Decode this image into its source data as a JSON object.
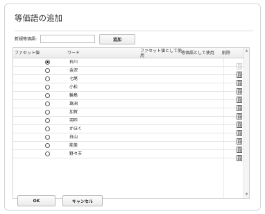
{
  "dialog": {
    "title": "等価語の追加",
    "new_synonym_label": "新規等価語:",
    "new_synonym_value": "",
    "add_button": "追加",
    "ok_button": "OK",
    "cancel_button": "キャンセル"
  },
  "grid": {
    "columns": {
      "facet_value": "ファセット値",
      "word": "ワード",
      "use_as_facet": "ファセット値として使用",
      "use_as_synonym": "等価語として使用",
      "delete": "削除"
    },
    "rows": [
      {
        "word": "石川",
        "facet_selected": true,
        "delete_enabled": false
      },
      {
        "word": "金沢",
        "facet_selected": false,
        "delete_enabled": true
      },
      {
        "word": "七尾",
        "facet_selected": false,
        "delete_enabled": true
      },
      {
        "word": "小松",
        "facet_selected": false,
        "delete_enabled": true
      },
      {
        "word": "輪島",
        "facet_selected": false,
        "delete_enabled": true
      },
      {
        "word": "珠洲",
        "facet_selected": false,
        "delete_enabled": true
      },
      {
        "word": "加賀",
        "facet_selected": false,
        "delete_enabled": true
      },
      {
        "word": "羽咋",
        "facet_selected": false,
        "delete_enabled": true
      },
      {
        "word": "かほく",
        "facet_selected": false,
        "delete_enabled": true
      },
      {
        "word": "白山",
        "facet_selected": false,
        "delete_enabled": true
      },
      {
        "word": "能美",
        "facet_selected": false,
        "delete_enabled": true
      },
      {
        "word": "野々市",
        "facet_selected": false,
        "delete_enabled": true
      }
    ],
    "delete_icon": "trash-icon"
  }
}
